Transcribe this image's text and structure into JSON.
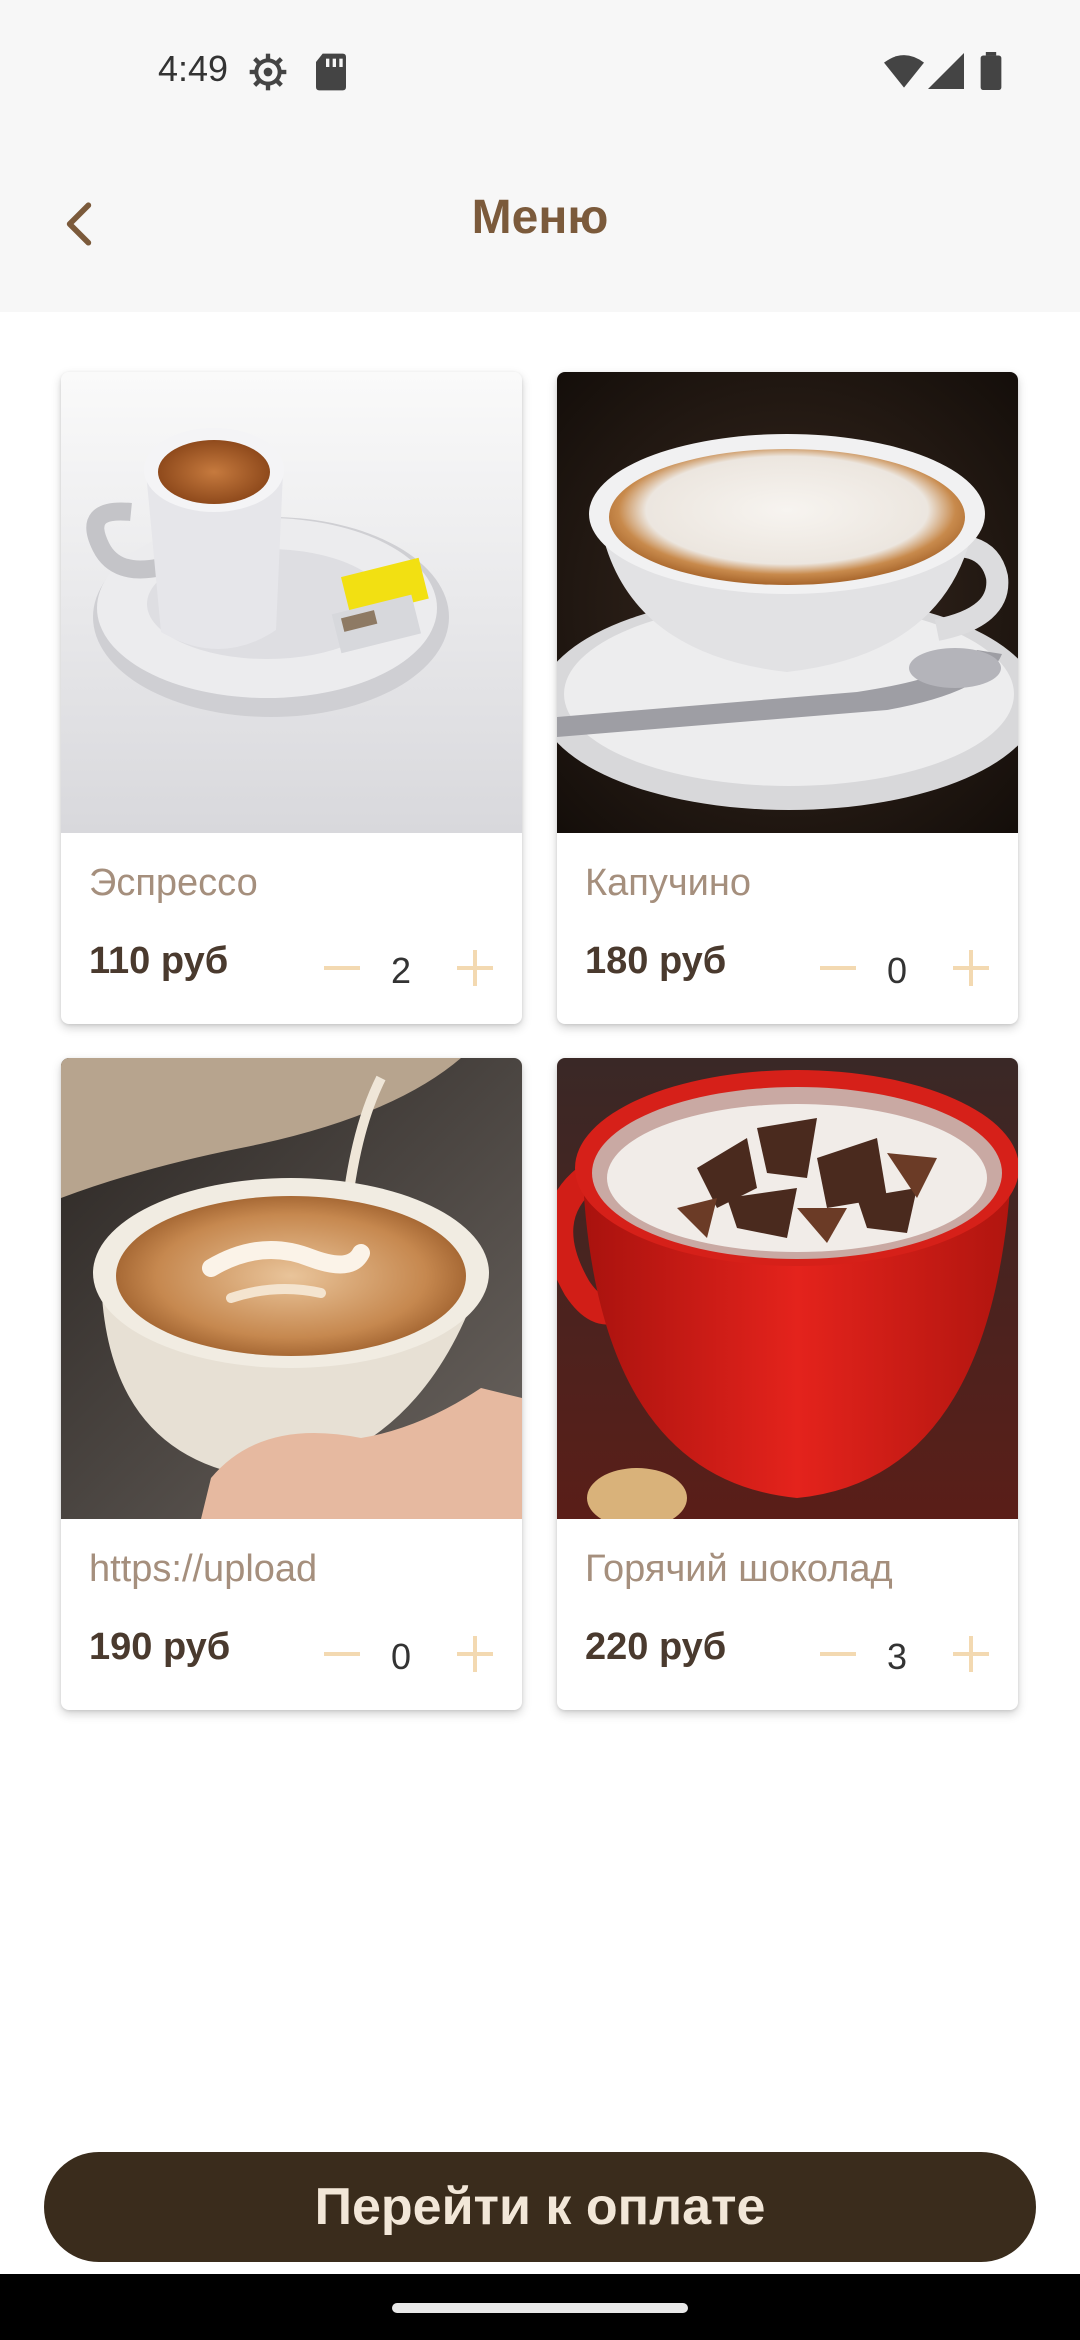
{
  "status_bar": {
    "time": "4:49",
    "icons": [
      "settings-icon",
      "sd-card-icon",
      "wifi-icon",
      "signal-icon",
      "battery-icon"
    ]
  },
  "app_bar": {
    "title": "Меню",
    "back_icon": "chevron-left-icon"
  },
  "menu": {
    "items": [
      {
        "name": "Эспрессо",
        "price": "110 руб",
        "quantity": "2",
        "image": "espresso-photo"
      },
      {
        "name": "Капучино",
        "price": "180 руб",
        "quantity": "0",
        "image": "cappuccino-photo"
      },
      {
        "name": "https://upload",
        "price": "190 руб",
        "quantity": "0",
        "image": "latte-photo"
      },
      {
        "name": "Горячий шоколад",
        "price": "220 руб",
        "quantity": "3",
        "image": "hot-chocolate-photo"
      }
    ]
  },
  "footer": {
    "pay_button_label": "Перейти к оплате"
  },
  "colors": {
    "accent_brown": "#7b5a3b",
    "button_dark": "#3a2c1c",
    "stepper": "#f3d9b1",
    "name_text": "#a58f7d"
  }
}
